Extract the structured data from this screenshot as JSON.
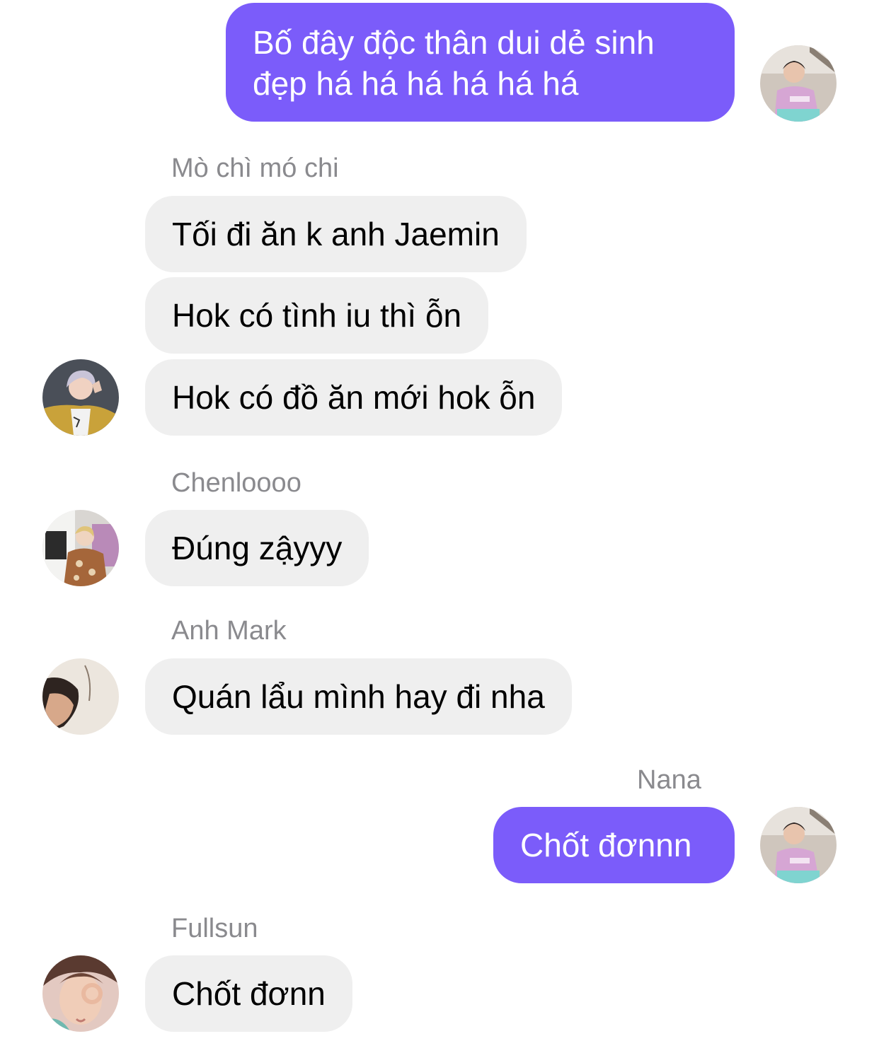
{
  "chat": {
    "messages": [
      {
        "sender": "",
        "text": "Bố đây độc thân dui dẻ sinh đẹp há há há há há há",
        "direction": "out"
      },
      {
        "sender": "Mò chì mó chi",
        "text": "Tối đi ăn k anh Jaemin",
        "direction": "in"
      },
      {
        "sender": "",
        "text": "Hok có tình iu thì ỗn",
        "direction": "in"
      },
      {
        "sender": "",
        "text": "Hok có đồ ăn mới hok ỗn",
        "direction": "in"
      },
      {
        "sender": "Chenloooo",
        "text": "Đúng zậyyy",
        "direction": "in"
      },
      {
        "sender": "Anh Mark",
        "text": "Quán lẩu mình hay đi nha",
        "direction": "in"
      },
      {
        "sender": "Nana",
        "text": "Chốt đơnnn",
        "direction": "out"
      },
      {
        "sender": "Fullsun",
        "text": "Chốt đơnn",
        "direction": "in"
      }
    ],
    "avatars": {
      "self": "avatar-nana-icon",
      "mo_chi_mo_chi": "avatar-mo-chi-icon",
      "chenloooo": "avatar-chenloooo-icon",
      "anh_mark": "avatar-anh-mark-icon",
      "fullsun": "avatar-fullsun-icon"
    }
  },
  "colors": {
    "outgoing_bubble": "#7b5cfa",
    "incoming_bubble": "#efefef",
    "sender_name": "#8a8a8e"
  }
}
